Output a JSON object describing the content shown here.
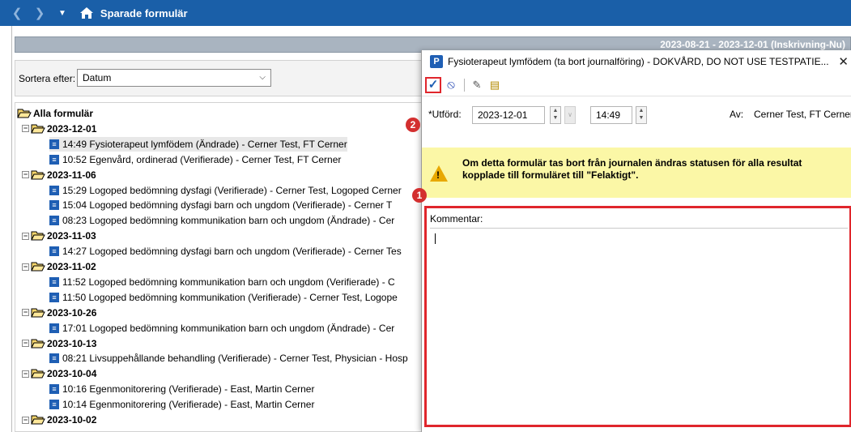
{
  "window": {
    "title": "Sparade formulär"
  },
  "infobar": {
    "text": "2023-08-21 - 2023-12-01 (Inskrivning-Nu)"
  },
  "sort": {
    "label": "Sortera efter:",
    "selected": "Datum"
  },
  "tree": {
    "root": "Alla formulär",
    "rows": [
      {
        "kind": "date",
        "text": "2023-12-01"
      },
      {
        "kind": "item",
        "text": "14:49  Fysioterapeut lymfödem (Ändrade) - Cerner Test, FT Cerner",
        "selected": true
      },
      {
        "kind": "item",
        "text": "10:52  Egenvård, ordinerad (Verifierade) - Cerner Test, FT Cerner"
      },
      {
        "kind": "date",
        "text": "2023-11-06"
      },
      {
        "kind": "item",
        "text": "15:29  Logoped bedömning dysfagi (Verifierade) - Cerner Test, Logoped Cerner"
      },
      {
        "kind": "item",
        "text": "15:04  Logoped bedömning dysfagi barn och ungdom (Verifierade) - Cerner T"
      },
      {
        "kind": "item",
        "text": "08:23  Logoped bedömning kommunikation barn och ungdom (Ändrade) - Cer"
      },
      {
        "kind": "date",
        "text": "2023-11-03"
      },
      {
        "kind": "item",
        "text": "14:27  Logoped bedömning dysfagi barn och ungdom (Verifierade) - Cerner Tes"
      },
      {
        "kind": "date",
        "text": "2023-11-02"
      },
      {
        "kind": "item",
        "text": "11:52  Logoped bedömning kommunikation barn och ungdom (Verifierade) - C"
      },
      {
        "kind": "item",
        "text": "11:50  Logoped bedömning kommunikation (Verifierade) - Cerner Test, Logope"
      },
      {
        "kind": "date",
        "text": "2023-10-26"
      },
      {
        "kind": "item",
        "text": "17:01  Logoped bedömning kommunikation barn och ungdom (Ändrade) - Cer"
      },
      {
        "kind": "date",
        "text": "2023-10-13"
      },
      {
        "kind": "item",
        "text": "08:21  Livsuppehållande behandling (Verifierade) - Cerner Test, Physician - Hosp"
      },
      {
        "kind": "date",
        "text": "2023-10-04"
      },
      {
        "kind": "item",
        "text": "10:16  Egenmonitorering (Verifierade) - East, Martin Cerner"
      },
      {
        "kind": "item",
        "text": "10:14  Egenmonitorering (Verifierade) - East, Martin Cerner"
      },
      {
        "kind": "date",
        "text": "2023-10-02"
      }
    ]
  },
  "dialog": {
    "title": "Fysioterapeut lymfödem (ta bort journalföring) - DOKVÅRD, DO NOT USE TESTPATIE...",
    "close_glyph": "✕",
    "app_icon": "P",
    "toolbar": {
      "check_glyph": "✓",
      "cancel_glyph": "⦸",
      "pen_glyph": "✎",
      "book_glyph": "▤"
    },
    "utford_label": "*Utförd:",
    "date_value": "2023-12-01",
    "time_value": "14:49",
    "av_label": "Av:",
    "av_value": "Cerner Test, FT Cerner",
    "warning": "Om detta formulär tas bort från journalen ändras statusen för alla resultat kopplade till formuläret till \"Felaktigt\".",
    "comment_label": "Kommentar:",
    "comment_value": ""
  },
  "badges": {
    "one": "1",
    "two": "2"
  },
  "colors": {
    "titlebar": "#1a5fa8",
    "highlight": "#e0262c",
    "warning_bg": "#fbf7a6"
  }
}
